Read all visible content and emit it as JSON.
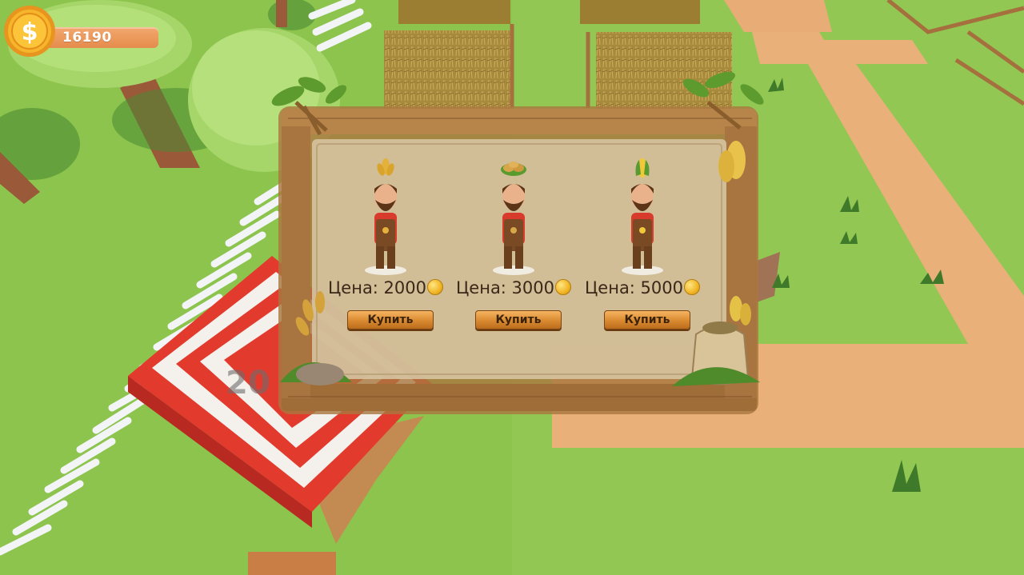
{
  "hud": {
    "coins": "16190",
    "coin_icon": "dollar-coin-icon"
  },
  "shop": {
    "title": "",
    "items": [
      {
        "crop_icon": "wheat-icon",
        "price_label": "Цена: 2000",
        "buy_label": "Купить"
      },
      {
        "crop_icon": "potato-icon",
        "price_label": "Цена: 3000",
        "buy_label": "Купить"
      },
      {
        "crop_icon": "corn-icon",
        "price_label": "Цена: 5000",
        "buy_label": "Купить"
      }
    ]
  },
  "scene": {
    "stall_price_partial": "20"
  },
  "colors": {
    "grass": "#8cc44d",
    "path": "#e9b07a",
    "panel_wood": "#a9773f",
    "parchment": "#d6c3a0",
    "coin": "#f0b526",
    "awning_red": "#e23b2e"
  }
}
